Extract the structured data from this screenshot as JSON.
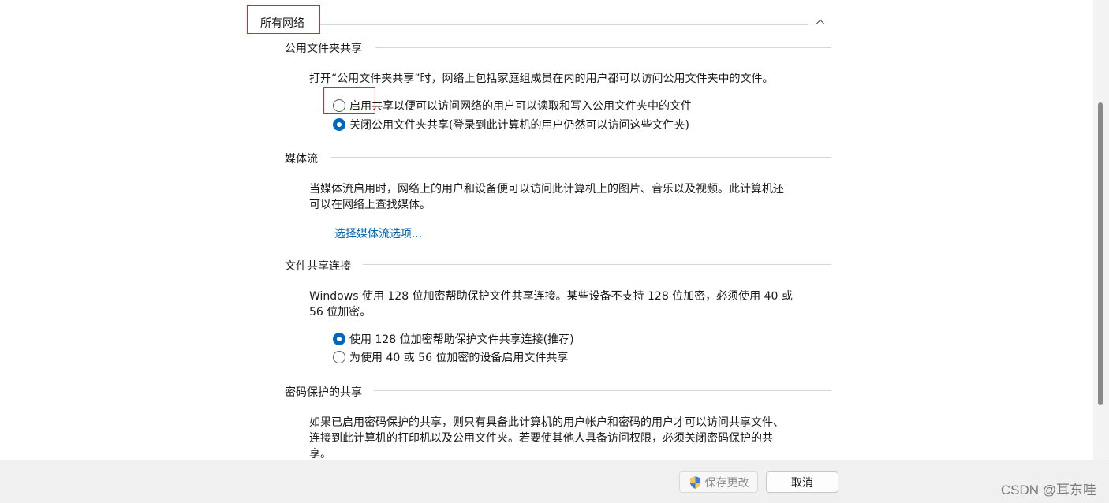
{
  "group": {
    "title": "所有网络",
    "collapse_icon": "chevron-up-icon"
  },
  "public_folder": {
    "heading": "公用文件夹共享",
    "description": "打开“公用文件夹共享”时，网络上包括家庭组成员在内的用户都可以访问公用文件夹中的文件。",
    "options": [
      {
        "label": "启用共享以便可以访问网络的用户可以读取和写入公用文件夹中的文件",
        "checked": false
      },
      {
        "label": "关闭公用文件夹共享(登录到此计算机的用户仍然可以访问这些文件夹)",
        "checked": true
      }
    ]
  },
  "media": {
    "heading": "媒体流",
    "description_line1": "当媒体流启用时，网络上的用户和设备便可以访问此计算机上的图片、音乐以及视频。此计算机还",
    "description_line2": "可以在网络上查找媒体。",
    "link": "选择媒体流选项..."
  },
  "file_sharing": {
    "heading": "文件共享连接",
    "description_line1": "Windows 使用 128 位加密帮助保护文件共享连接。某些设备不支持 128 位加密，必须使用 40 或",
    "description_line2": "56 位加密。",
    "options": [
      {
        "label": "使用 128 位加密帮助保护文件共享连接(推荐)",
        "checked": true
      },
      {
        "label": "为使用 40 或 56 位加密的设备启用文件共享",
        "checked": false
      }
    ]
  },
  "password": {
    "heading": "密码保护的共享",
    "description_line1": "如果已启用密码保护的共享，则只有具备此计算机的用户帐户和密码的用户才可以访问共享文件、",
    "description_line2": "连接到此计算机的打印机以及公用文件夹。若要使其他人具备访问权限，必须关闭密码保护的共",
    "description_line3": "享。"
  },
  "footer": {
    "save_label": "保存更改",
    "save_icon": "uac-shield-icon",
    "cancel_label": "取消",
    "watermark": "CSDN @耳东哇"
  },
  "colors": {
    "accent": "#0067c0",
    "link": "#0066b4",
    "highlight_box": "#e0242d"
  }
}
